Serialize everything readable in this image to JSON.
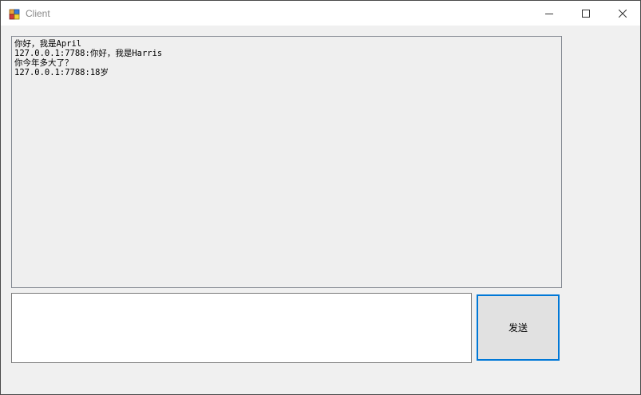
{
  "window": {
    "title": "Client",
    "icon": "windows-forms-app-icon"
  },
  "caption_buttons": {
    "minimize_icon": "minimize-icon",
    "maximize_icon": "maximize-icon",
    "close_icon": "close-icon"
  },
  "chat_log": {
    "lines": [
      "你好，我是April",
      "127.0.0.1:7788:你好，我是Harris",
      "你今年多大了？",
      "127.0.0.1:7788:18岁"
    ]
  },
  "message_input": {
    "value": ""
  },
  "send_button": {
    "label": "发送"
  },
  "colors": {
    "accent": "#0078d7",
    "window_bg": "#f0f0f0",
    "chat_bg": "#efefef",
    "button_bg": "#e1e1e1"
  }
}
